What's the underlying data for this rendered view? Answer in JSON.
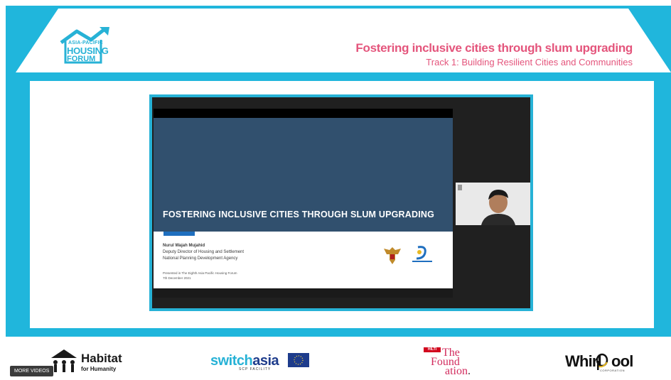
{
  "header": {
    "logo_line1": "ASIA-PACIFIC",
    "logo_line2": "HOUSING",
    "logo_line3": "FORUM",
    "title": "Fostering inclusive cities through slum upgrading",
    "subtitle": "Track 1: Building Resilient Cities and Communities"
  },
  "slide": {
    "title": "FOSTERING INCLUSIVE CITIES THROUGH SLUM UPGRADING",
    "presenter": "Nurul Wajah Mujahid",
    "role": "Deputy Director of Housing and Settlement",
    "org": "National Planning Development Agency",
    "presented_at": "Presented in The Eighth Asia Pacific Housing Forum",
    "date": "7th December 2021"
  },
  "colors": {
    "frame": "#20b6dc",
    "title": "#e4557c",
    "slide_blue": "#31506e"
  },
  "footer": {
    "more_videos": "MORE VIDEOS",
    "habitat_line1": "Habitat",
    "habitat_line2": "for Humanity",
    "switch_a": "switch",
    "switch_b": "asia",
    "switch_sub": "SCP FACILITY",
    "hilti": "HILTI",
    "foundation_1": "The",
    "foundation_2": "Found",
    "foundation_3": "ation",
    "foundation_dot": ".",
    "whirlpool_a": "Whirl",
    "whirlpool_b": "ool",
    "whirlpool_sub": "CORPORATION"
  }
}
